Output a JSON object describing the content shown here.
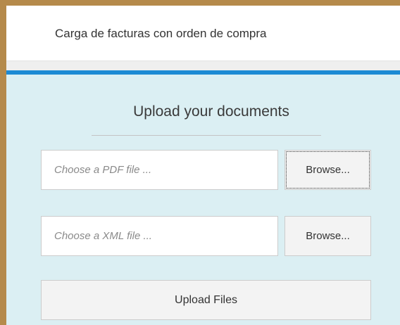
{
  "header": {
    "title": "Carga de facturas con orden de compra"
  },
  "upload_panel": {
    "title": "Upload your documents",
    "pdf": {
      "placeholder": "Choose a PDF file ...",
      "browse_label": "Browse..."
    },
    "xml": {
      "placeholder": "Choose a XML file ...",
      "browse_label": "Browse..."
    },
    "upload_label": "Upload Files"
  },
  "colors": {
    "frame_border": "#b58a4b",
    "accent_bar": "#1c8ad4",
    "panel_background": "#dbeff3"
  }
}
